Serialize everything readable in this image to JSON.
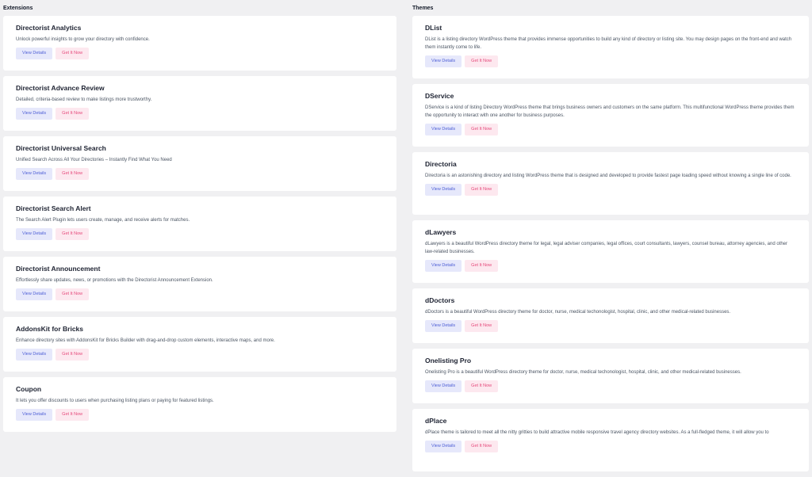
{
  "extensions": {
    "heading": "Extensions",
    "items": [
      {
        "title": "Directorist Analytics",
        "desc": "Unlock powerful insights to grow your directory with confidence.",
        "view": "View Details",
        "get": "Get It Now"
      },
      {
        "title": "Directorist Advance Review",
        "desc": "Detailed, criteria-based review to make listings more trustworthy.",
        "view": "View Details",
        "get": "Get It Now"
      },
      {
        "title": "Directorist Universal Search",
        "desc": "Unified Search Across All Your Directories – Instantly Find What You Need",
        "view": "View Details",
        "get": "Get It Now"
      },
      {
        "title": "Directorist Search Alert",
        "desc": "The Search Alert Plugin lets users create, manage, and receive alerts for matches.",
        "view": "View Details",
        "get": "Get It Now"
      },
      {
        "title": "Directorist Announcement",
        "desc": "Effortlessly share updates, news, or promotions with the Directorist Announcement Extension.",
        "view": "View Details",
        "get": "Get It Now"
      },
      {
        "title": "AddonsKit for Bricks",
        "desc": "Enhance directory sites with AddonsKit for Bricks Builder with drag-and-drop custom elements, interactive maps, and more.",
        "view": "View Details",
        "get": "Get It Now"
      },
      {
        "title": "Coupon",
        "desc": "It lets you offer discounts to users when purchasing listing plans or paying for featured listings.",
        "view": "View Details",
        "get": "Get It Now"
      }
    ]
  },
  "themes": {
    "heading": "Themes",
    "items": [
      {
        "title": "DList",
        "desc": "DList is a listing directory WordPress theme that provides immense opportunities to build any kind of directory or listing site. You may design pages on the front-end and watch them instantly come to life.",
        "view": "View Details",
        "get": "Get It Now"
      },
      {
        "title": "DService",
        "desc": "DService is a kind of listing Directory WordPress theme that brings business owners and customers on the same platform. This multifunctional WordPress theme provides them the opportunity to interact with one another for business purposes.",
        "view": "View Details",
        "get": "Get It Now"
      },
      {
        "title": "Directoria",
        "desc": "Directoria is an astonishing directory and listing WordPress theme that is designed and developed to provide fastest page loading speed without knowing a single line of code.",
        "view": "View Details",
        "get": "Get It Now"
      },
      {
        "title": "dLawyers",
        "desc": "dLawyers is a beautiful WordPress directory theme for legal, legal adviser companies, legal offices, court consultants, lawyers, counsel bureau, attorney agencies, and other law-related businesses.",
        "view": "View Details",
        "get": "Get It Now"
      },
      {
        "title": "dDoctors",
        "desc": "dDoctors is a beautiful WordPress directory theme for doctor, nurse, medical techonologist, hospital, clinic, and other medical-related businesses.",
        "view": "View Details",
        "get": "Get It Now"
      },
      {
        "title": "Onelisting Pro",
        "desc": "Onelisting Pro is a beautiful WordPress directory theme for doctor, nurse, medical techonologist, hospital, clinic, and other medical-related businesses.",
        "view": "View Details",
        "get": "Get It Now"
      },
      {
        "title": "dPlace",
        "desc": "dPlace theme is tailored to meet all the nitty gritties to build attractive mobile responsive travel agency directory websites. As a full-fledged theme, it will allow you to",
        "view": "View Details",
        "get": "Get It Now"
      }
    ]
  }
}
